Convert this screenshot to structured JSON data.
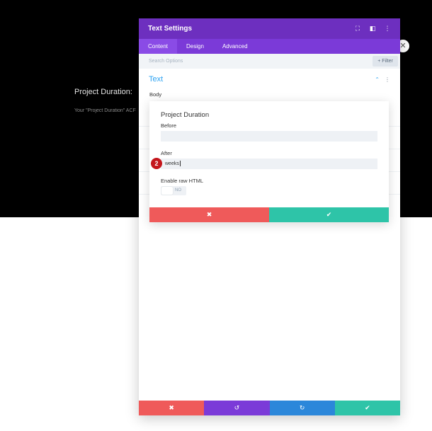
{
  "background": {
    "heading": "Project Duration:",
    "subtext": "Your \"Project Duration\" ACF",
    "close_glyph": "✕"
  },
  "modal": {
    "title": "Text Settings",
    "header_icons": {
      "fullscreen": "⛶",
      "sidebar": "◧",
      "more": "⋮"
    },
    "tabs": [
      {
        "label": "Content",
        "active": true
      },
      {
        "label": "Design",
        "active": false
      },
      {
        "label": "Advanced",
        "active": false
      }
    ],
    "search": {
      "placeholder": "Search Options",
      "filter_label": "+ Filter"
    },
    "section": {
      "title": "Text",
      "caret": "⌃",
      "dots": "⋮"
    },
    "body_label": "Body"
  },
  "popup": {
    "title": "Project Duration",
    "before": {
      "label": "Before",
      "value": ""
    },
    "after": {
      "label": "After",
      "value": "weeks"
    },
    "step_badge": "2",
    "raw_html": {
      "label": "Enable raw HTML",
      "state": "NO"
    },
    "cancel_glyph": "✖",
    "confirm_glyph": "✔"
  },
  "footer": {
    "cancel_glyph": "✖",
    "undo_glyph": "↺",
    "redo_glyph": "↻",
    "save_glyph": "✔"
  },
  "colors": {
    "header": "#6d2fbf",
    "tabs": "#7b3ad8",
    "accent_blue": "#2ea3f2",
    "danger": "#ef5a5a",
    "success": "#2ec4a8",
    "purple": "#7b3ad8",
    "blue": "#2b87da",
    "badge": "#c4161c"
  }
}
